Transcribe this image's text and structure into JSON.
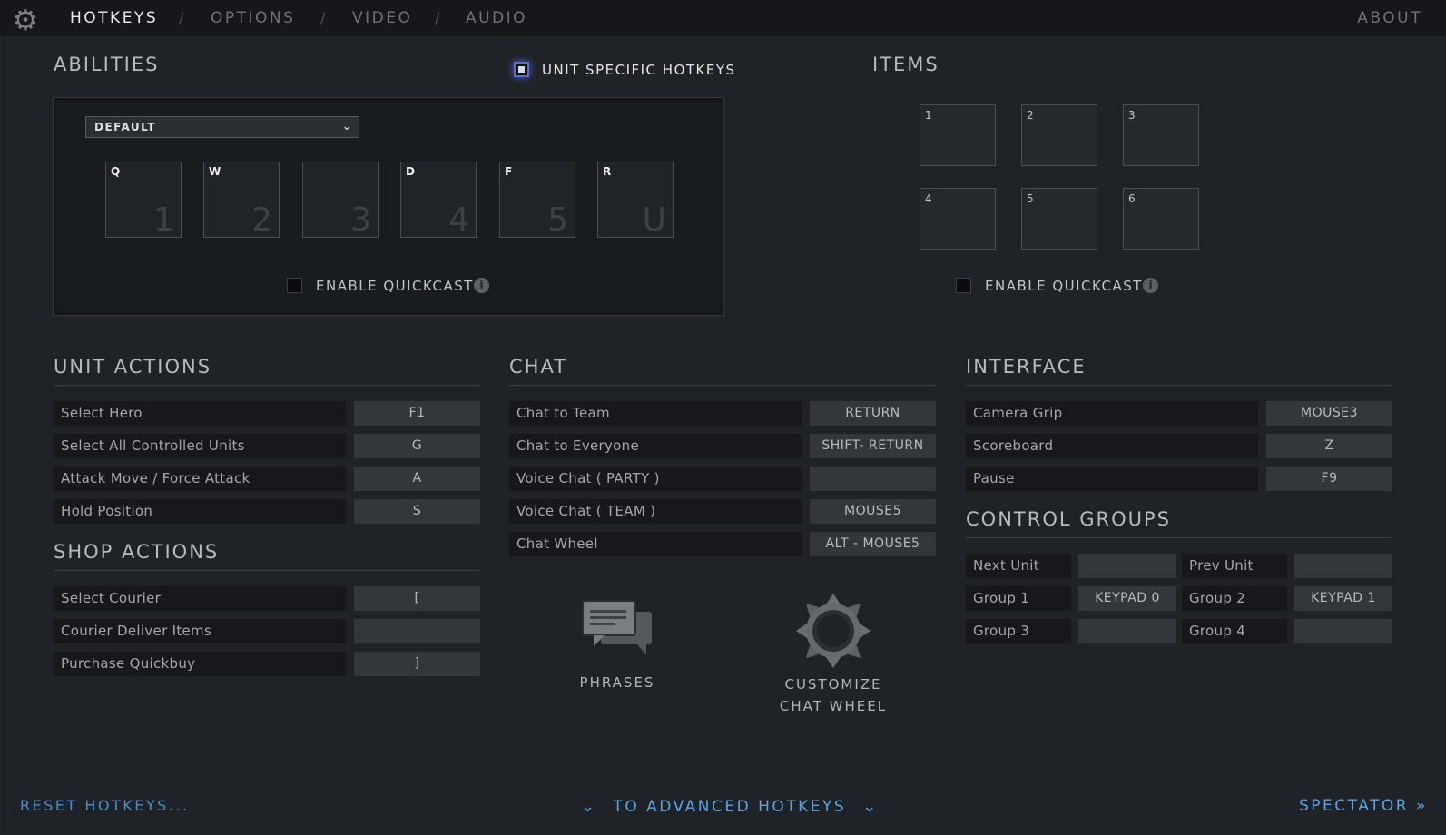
{
  "nav": {
    "tabs": [
      "HOTKEYS",
      "OPTIONS",
      "VIDEO",
      "AUDIO"
    ],
    "separators": [
      "/",
      "/",
      "/"
    ],
    "about": "ABOUT"
  },
  "abilities": {
    "title": "ABILITIES",
    "unit_specific_label": "UNIT SPECIFIC HOTKEYS",
    "dropdown_value": "DEFAULT",
    "slots": [
      {
        "key": "Q",
        "num": "1"
      },
      {
        "key": "W",
        "num": "2"
      },
      {
        "key": "",
        "num": "3"
      },
      {
        "key": "D",
        "num": "4"
      },
      {
        "key": "F",
        "num": "5"
      },
      {
        "key": "R",
        "num": "U"
      }
    ],
    "quickcast_label": "ENABLE QUICKCAST"
  },
  "items": {
    "title": "ITEMS",
    "slots": [
      "1",
      "2",
      "3",
      "4",
      "5",
      "6"
    ],
    "quickcast_label": "ENABLE QUICKCAST"
  },
  "unit_actions": {
    "title": "UNIT ACTIONS",
    "rows": [
      {
        "label": "Select Hero",
        "key": "F1"
      },
      {
        "label": "Select All Controlled Units",
        "key": "G"
      },
      {
        "label": "Attack Move / Force Attack",
        "key": "A"
      },
      {
        "label": "Hold Position",
        "key": "S"
      }
    ]
  },
  "shop_actions": {
    "title": "SHOP ACTIONS",
    "rows": [
      {
        "label": "Select Courier",
        "key": "["
      },
      {
        "label": "Courier Deliver Items",
        "key": ""
      },
      {
        "label": "Purchase Quickbuy",
        "key": "]"
      }
    ]
  },
  "chat": {
    "title": "CHAT",
    "rows": [
      {
        "label": "Chat to Team",
        "key": "RETURN"
      },
      {
        "label": "Chat to Everyone",
        "key": "SHIFT- RETURN"
      },
      {
        "label": "Voice Chat ( PARTY )",
        "key": ""
      },
      {
        "label": "Voice Chat ( TEAM )",
        "key": "MOUSE5"
      },
      {
        "label": "Chat Wheel",
        "key": "ALT - MOUSE5"
      }
    ],
    "phrases_label": "PHRASES",
    "customize_line1": "CUSTOMIZE",
    "customize_line2": "CHAT WHEEL"
  },
  "interface": {
    "title": "INTERFACE",
    "rows": [
      {
        "label": "Camera Grip",
        "key": "MOUSE3"
      },
      {
        "label": "Scoreboard",
        "key": "Z"
      },
      {
        "label": "Pause",
        "key": "F9"
      }
    ]
  },
  "control_groups": {
    "title": "CONTROL GROUPS",
    "rows": [
      {
        "label": "Next Unit",
        "key": ""
      },
      {
        "label": "Prev Unit",
        "key": ""
      },
      {
        "label": "Group 1",
        "key": "KEYPAD 0"
      },
      {
        "label": "Group 2",
        "key": "KEYPAD 1"
      },
      {
        "label": "Group 3",
        "key": ""
      },
      {
        "label": "Group 4",
        "key": ""
      }
    ]
  },
  "footer": {
    "reset": "RESET HOTKEYS...",
    "advanced": "TO ADVANCED HOTKEYS",
    "spectator": "SPECTATOR"
  },
  "icons": {
    "settings": "gear-icon",
    "chat": "speech-bubbles-icon",
    "wheel": "chat-wheel-icon",
    "info": "info-icon"
  },
  "colors": {
    "accent_blue": "#5da3e0",
    "glow": "#5566dd"
  }
}
